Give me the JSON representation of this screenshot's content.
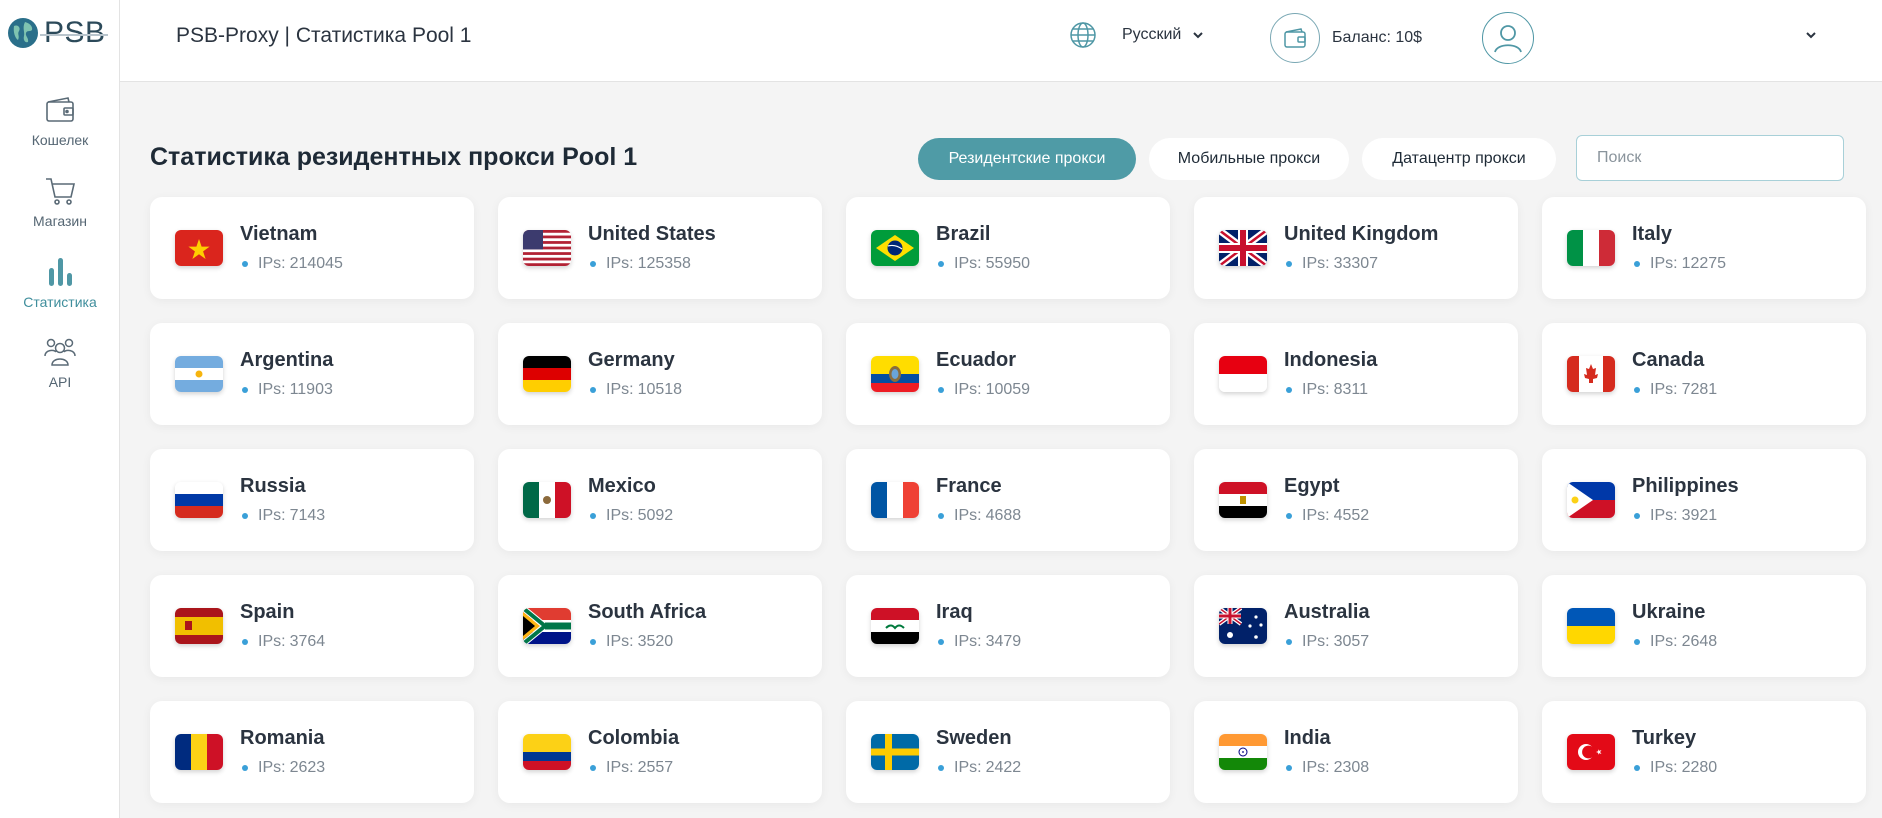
{
  "brand": {
    "name": "PSB"
  },
  "sidebar": {
    "items": [
      {
        "label": "Кошелек",
        "icon": "wallet-icon",
        "active": false
      },
      {
        "label": "Магазин",
        "icon": "cart-icon",
        "active": false
      },
      {
        "label": "Статистика",
        "icon": "bar-chart-icon",
        "active": true
      },
      {
        "label": "API",
        "icon": "users-icon",
        "active": false
      }
    ]
  },
  "header": {
    "title": "PSB-Proxy | Статистика Pool 1",
    "language": "Русский",
    "balance": "Баланс: 10$"
  },
  "main": {
    "heading": "Статистика резидентных прокси Pool 1",
    "tabs": [
      {
        "label": "Резидентские прокси",
        "active": true
      },
      {
        "label": "Мобильные прокси",
        "active": false
      },
      {
        "label": "Датацентр прокси",
        "active": false
      }
    ],
    "search_placeholder": "Поиск",
    "ips_label": "IPs:",
    "countries": [
      {
        "name": "Vietnam",
        "ips": "214045",
        "flag": "vn"
      },
      {
        "name": "United States",
        "ips": "125358",
        "flag": "us"
      },
      {
        "name": "Brazil",
        "ips": "55950",
        "flag": "br"
      },
      {
        "name": "United Kingdom",
        "ips": "33307",
        "flag": "gb"
      },
      {
        "name": "Italy",
        "ips": "12275",
        "flag": "it"
      },
      {
        "name": "Argentina",
        "ips": "11903",
        "flag": "ar"
      },
      {
        "name": "Germany",
        "ips": "10518",
        "flag": "de"
      },
      {
        "name": "Ecuador",
        "ips": "10059",
        "flag": "ec"
      },
      {
        "name": "Indonesia",
        "ips": "8311",
        "flag": "id"
      },
      {
        "name": "Canada",
        "ips": "7281",
        "flag": "ca"
      },
      {
        "name": "Russia",
        "ips": "7143",
        "flag": "ru"
      },
      {
        "name": "Mexico",
        "ips": "5092",
        "flag": "mx"
      },
      {
        "name": "France",
        "ips": "4688",
        "flag": "fr"
      },
      {
        "name": "Egypt",
        "ips": "4552",
        "flag": "eg"
      },
      {
        "name": "Philippines",
        "ips": "3921",
        "flag": "ph"
      },
      {
        "name": "Spain",
        "ips": "3764",
        "flag": "es"
      },
      {
        "name": "South Africa",
        "ips": "3520",
        "flag": "za"
      },
      {
        "name": "Iraq",
        "ips": "3479",
        "flag": "iq"
      },
      {
        "name": "Australia",
        "ips": "3057",
        "flag": "au"
      },
      {
        "name": "Ukraine",
        "ips": "2648",
        "flag": "ua"
      },
      {
        "name": "Romania",
        "ips": "2623",
        "flag": "ro"
      },
      {
        "name": "Colombia",
        "ips": "2557",
        "flag": "co"
      },
      {
        "name": "Sweden",
        "ips": "2422",
        "flag": "se"
      },
      {
        "name": "India",
        "ips": "2308",
        "flag": "in"
      },
      {
        "name": "Turkey",
        "ips": "2280",
        "flag": "tr"
      }
    ]
  }
}
